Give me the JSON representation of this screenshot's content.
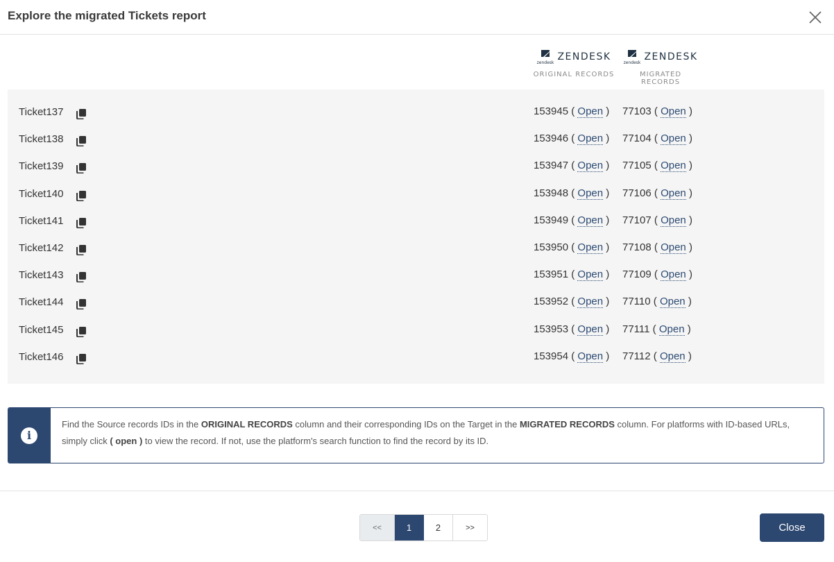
{
  "modal": {
    "title": "Explore the migrated Tickets report",
    "close_icon": "close-icon"
  },
  "columns": {
    "original": {
      "brand": "ZENDESK",
      "brand_small": "zendesk",
      "label": "ORIGINAL RECORDS"
    },
    "migrated": {
      "brand": "ZENDESK",
      "brand_small": "zendesk",
      "label": "MIGRATED RECORDS"
    }
  },
  "rows": [
    {
      "name": "Ticket137",
      "original_id": "153945",
      "migrated_id": "77103"
    },
    {
      "name": "Ticket138",
      "original_id": "153946",
      "migrated_id": "77104"
    },
    {
      "name": "Ticket139",
      "original_id": "153947",
      "migrated_id": "77105"
    },
    {
      "name": "Ticket140",
      "original_id": "153948",
      "migrated_id": "77106"
    },
    {
      "name": "Ticket141",
      "original_id": "153949",
      "migrated_id": "77107"
    },
    {
      "name": "Ticket142",
      "original_id": "153950",
      "migrated_id": "77108"
    },
    {
      "name": "Ticket143",
      "original_id": "153951",
      "migrated_id": "77109"
    },
    {
      "name": "Ticket144",
      "original_id": "153952",
      "migrated_id": "77110"
    },
    {
      "name": "Ticket145",
      "original_id": "153953",
      "migrated_id": "77111"
    },
    {
      "name": "Ticket146",
      "original_id": "153954",
      "migrated_id": "77112"
    }
  ],
  "open_label": "Open",
  "paren_open": "(",
  "paren_close": ")",
  "info": {
    "icon": "info-icon",
    "p1": "Find the Source records IDs in the ",
    "b1": "ORIGINAL RECORDS",
    "p2": " column and their corresponding IDs on the Target in the ",
    "b2": "MIGRATED RECORDS",
    "p3": " column. For platforms with ID-based URLs, simply click ",
    "b3": "( open )",
    "p4": " to view the record. If not, use the platform's search function to find the record by its ID."
  },
  "pagination": {
    "prev": "<<",
    "pages": [
      "1",
      "2"
    ],
    "current": "1",
    "next": ">>"
  },
  "footer": {
    "close_label": "Close"
  },
  "colors": {
    "accent": "#2c4770",
    "table_bg": "#f5f5f5",
    "link": "#2c4a72"
  }
}
